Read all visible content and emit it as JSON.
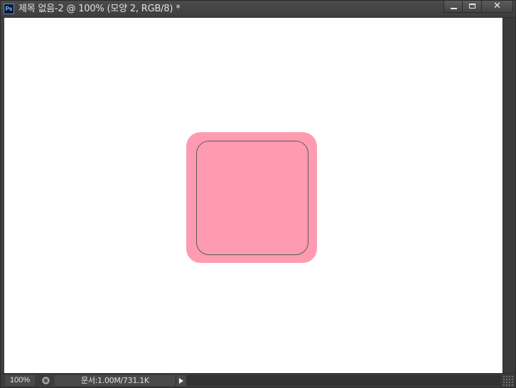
{
  "titlebar": {
    "app_icon_label": "Ps",
    "title": "제목 없음-2 @ 100% (모양 2, RGB/8) *"
  },
  "window_controls": {
    "minimize_icon": "minimize-icon",
    "maximize_icon": "maximize-icon",
    "close_icon": "close-icon",
    "close_glyph": "✕"
  },
  "canvas": {
    "background": "#ffffff",
    "shape": {
      "type": "rounded-rectangle",
      "fill": "#ff9bb0",
      "path_outline": "#5a5a5a"
    }
  },
  "statusbar": {
    "zoom": "100%",
    "doc_info": "문서:1.00M/731.1K"
  }
}
